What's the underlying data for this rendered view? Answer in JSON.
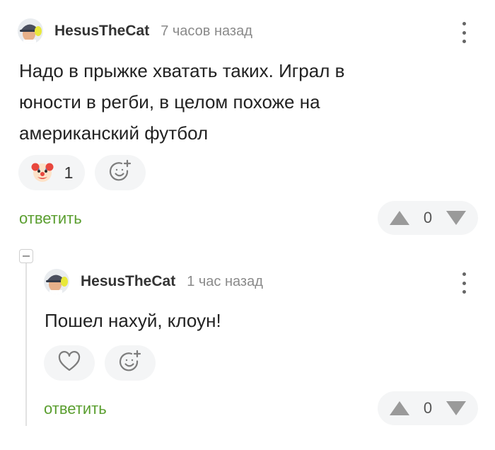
{
  "comments": [
    {
      "author": "HesusTheCat",
      "time": "7 часов назад",
      "text": "Надо в прыжке хватать таких. Играл в юности в регби, в целом похоже на американский футбол",
      "reaction": {
        "emoji": "clown-face-icon",
        "count": "1"
      },
      "reply_label": "ответить",
      "votes": "0"
    },
    {
      "author": "HesusTheCat",
      "time": "1 час назад",
      "text": "Пошел нахуй, клоун!",
      "reply_label": "ответить",
      "votes": "0"
    }
  ],
  "colors": {
    "reply": "#5a9e2f",
    "pill_bg": "#f4f5f6",
    "muted": "#8a8a8a"
  }
}
